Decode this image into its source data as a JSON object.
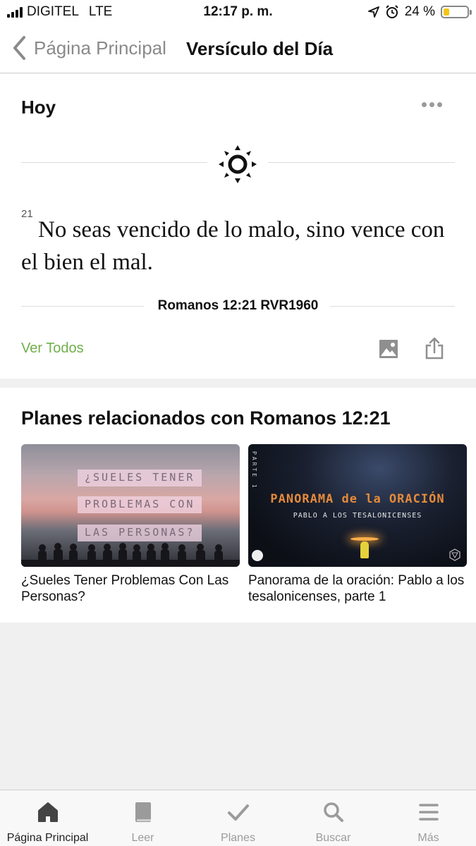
{
  "status_bar": {
    "carrier": "DIGITEL",
    "network": "LTE",
    "time": "12:17 p. m.",
    "battery_percent": "24 %",
    "battery_level": 0.24,
    "battery_color": "#f5c518"
  },
  "nav": {
    "back_label": "Página Principal",
    "title": "Versículo del Día"
  },
  "verse_card": {
    "heading": "Hoy",
    "verse_number": "21",
    "verse_text": "No seas vencido de lo malo, sino vence con el bien el mal.",
    "reference": "Romanos 12:21 RVR1960",
    "view_all_label": "Ver Todos",
    "accent_color": "#6fb04a"
  },
  "plans": {
    "title": "Planes relacionados con Romanos 12:21",
    "items": [
      {
        "title": "¿Sueles Tener Problemas Con Las Personas?",
        "image_text": [
          "¿SUELES TENER",
          "PROBLEMAS CON",
          "LAS PERSONAS?"
        ]
      },
      {
        "title": "Panorama de la oración: Pablo a los tesalonicenses, parte 1",
        "image_text_main": "PANORAMA de la ORACIÓN",
        "image_text_sub": "PABLO A LOS TESALONICENSES",
        "image_text_side": "PARTE 1"
      }
    ]
  },
  "tab_bar": {
    "tabs": [
      {
        "label": "Página Principal",
        "icon": "home-icon",
        "active": true
      },
      {
        "label": "Leer",
        "icon": "book-icon",
        "active": false
      },
      {
        "label": "Planes",
        "icon": "checkmark-icon",
        "active": false
      },
      {
        "label": "Buscar",
        "icon": "search-icon",
        "active": false
      },
      {
        "label": "Más",
        "icon": "menu-icon",
        "active": false
      }
    ]
  }
}
